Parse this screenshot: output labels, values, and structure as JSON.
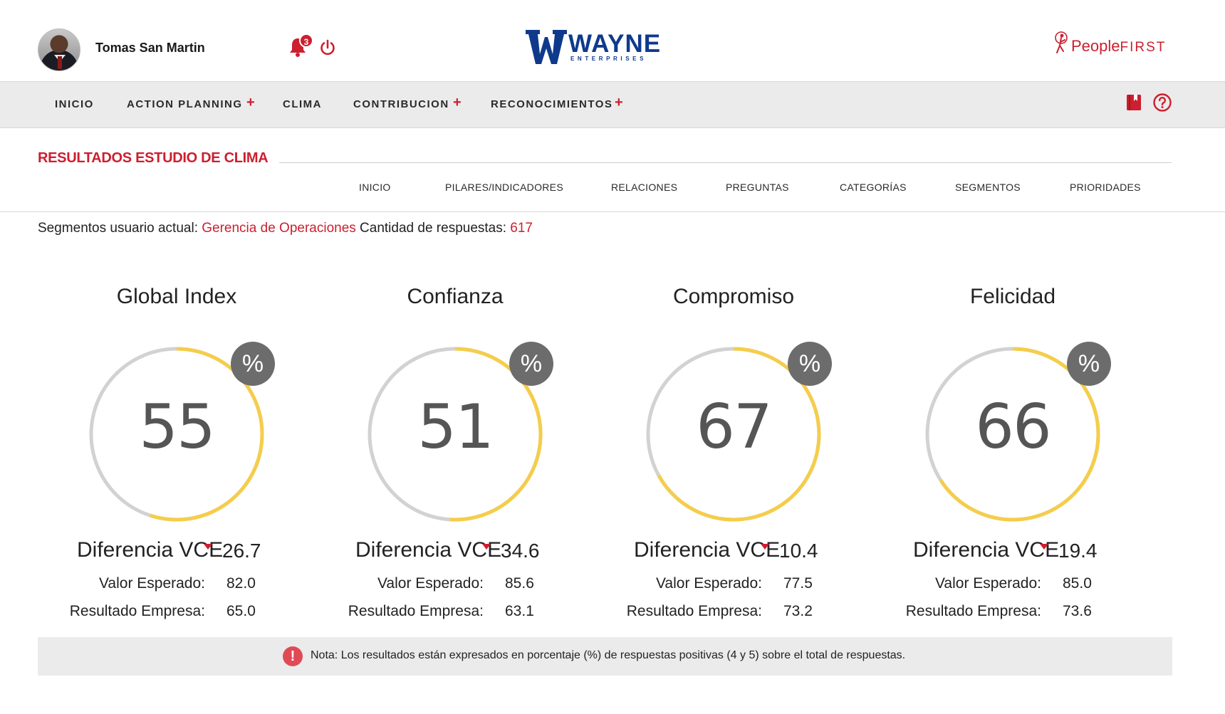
{
  "header": {
    "user_name": "Tomas San Martin",
    "notification_count": "3",
    "logo": {
      "wordmark": "WAYNE",
      "subtitle": "ENTERPRISES"
    },
    "partner_logo": {
      "people": "People",
      "first": "FIRST"
    }
  },
  "nav": {
    "items": [
      {
        "label": "INICIO",
        "has_plus": false
      },
      {
        "label": "ACTION PLANNING",
        "has_plus": true
      },
      {
        "label": "CLIMA",
        "has_plus": false
      },
      {
        "label": "CONTRIBUCION",
        "has_plus": true
      },
      {
        "label": "RECONOCIMIENTOS",
        "has_plus": true
      }
    ],
    "plus_symbol": "+"
  },
  "page": {
    "title": "RESULTADOS ESTUDIO DE CLIMA",
    "subnav": [
      "INICIO",
      "PILARES/INDICADORES",
      "RELACIONES",
      "PREGUNTAS",
      "CATEGORÍAS",
      "SEGMENTOS",
      "PRIORIDADES"
    ]
  },
  "info": {
    "segments_label": "Segmentos usuario actual:",
    "segments_value": "Gerencia de Operaciones",
    "responses_label": "Cantidad de respuestas:",
    "responses_value": "617"
  },
  "gauges": [
    {
      "title": "Global Index",
      "value": "55",
      "percent_symbol": "%",
      "diff_label": "Diferencia VCE",
      "diff_value": "26.7",
      "expected_label": "Valor Esperado:",
      "expected_value": "82.0",
      "result_label": "Resultado Empresa:",
      "result_value": "65.0"
    },
    {
      "title": "Confianza",
      "value": "51",
      "percent_symbol": "%",
      "diff_label": "Diferencia VCE",
      "diff_value": "34.6",
      "expected_label": "Valor Esperado:",
      "expected_value": "85.6",
      "result_label": "Resultado Empresa:",
      "result_value": "63.1"
    },
    {
      "title": "Compromiso",
      "value": "67",
      "percent_symbol": "%",
      "diff_label": "Diferencia VCE",
      "diff_value": "10.4",
      "expected_label": "Valor Esperado:",
      "expected_value": "77.5",
      "result_label": "Resultado Empresa:",
      "result_value": "73.2"
    },
    {
      "title": "Felicidad",
      "value": "66",
      "percent_symbol": "%",
      "diff_label": "Diferencia VCE",
      "diff_value": "19.4",
      "expected_label": "Valor Esperado:",
      "expected_value": "85.0",
      "result_label": "Resultado Empresa:",
      "result_value": "73.6"
    }
  ],
  "note": {
    "icon_symbol": "!",
    "text": "Nota: Los resultados están expresados en porcentaje (%) de respuestas positivas (4 y 5) sobre el total de respuestas."
  },
  "colors": {
    "accent_red": "#cc1f2f",
    "gauge_fill": "#f5cd4a",
    "gauge_track": "#d2d2d2",
    "badge_gray": "#6c6c6c",
    "brand_blue": "#0f3a8c"
  },
  "icons": {
    "bell": "bell-icon",
    "power": "power-icon",
    "book": "book-icon",
    "help": "help-icon",
    "alert": "alert-icon"
  }
}
